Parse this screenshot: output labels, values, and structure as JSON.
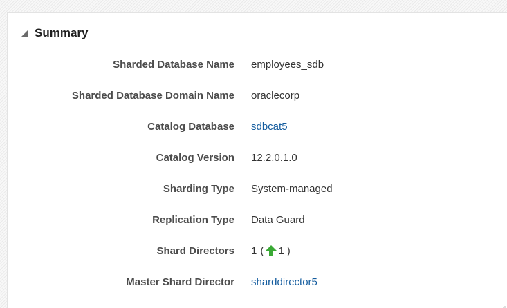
{
  "summary": {
    "title": "Summary",
    "rows": [
      {
        "label": "Sharded Database Name",
        "value": "employees_sdb"
      },
      {
        "label": "Sharded Database Domain Name",
        "value": "oraclecorp"
      },
      {
        "label": "Catalog Database",
        "value": "sdbcat5",
        "is_link": true
      },
      {
        "label": "Catalog Version",
        "value": "12.2.0.1.0"
      },
      {
        "label": "Sharding Type",
        "value": "System-managed"
      },
      {
        "label": "Replication Type",
        "value": "Data Guard"
      },
      {
        "label": "Shard Directors",
        "value_count": "1",
        "open_paren": "(",
        "up_count": "1",
        "close_paren": ")"
      },
      {
        "label": "Master Shard Director",
        "value": "sharddirector5",
        "is_link": true
      }
    ]
  },
  "icons": {
    "disclosure": "triangle-expanded-icon",
    "status_up": "up-arrow-icon",
    "resize": "resize-grip-icon"
  },
  "colors": {
    "link": "#145c9e",
    "label": "#4c4c4c",
    "value": "#333333",
    "status_up": "#3aa935"
  }
}
